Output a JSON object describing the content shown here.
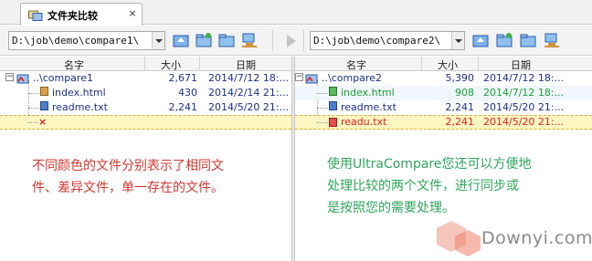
{
  "tab": {
    "label": "文件夹比较",
    "close": "×"
  },
  "left": {
    "path": "D:\\job\\demo\\compare1\\",
    "headers": {
      "name": "名字",
      "size": "大小",
      "date": "日期"
    },
    "rows": [
      {
        "name": "..\\compare1",
        "size": "2,671",
        "date": "2014/7/12 18:...",
        "color": "#1b2f8a",
        "icon": "folder-icon"
      },
      {
        "name": "index.html",
        "size": "430",
        "date": "2014/2/14 21:...",
        "color": "#1b2f8a",
        "icon": "html-file-icon"
      },
      {
        "name": "readme.txt",
        "size": "2,241",
        "date": "2014/5/20 21:...",
        "color": "#1b2f8a",
        "icon": "txt-file-icon"
      },
      {
        "name": "×",
        "size": "",
        "date": "",
        "color": "#e02020",
        "icon": "missing-file-icon"
      }
    ]
  },
  "right": {
    "path": "D:\\job\\demo\\compare2\\",
    "headers": {
      "name": "名字",
      "size": "大小",
      "date": "日期"
    },
    "rows": [
      {
        "name": "..\\compare2",
        "size": "5,390",
        "date": "2014/7/12 18:...",
        "color": "#1b2f8a",
        "icon": "folder-icon"
      },
      {
        "name": "index.html",
        "size": "908",
        "date": "2014/7/12 18:...",
        "color": "#18a030",
        "icon": "html-file-icon"
      },
      {
        "name": "readme.txt",
        "size": "2,241",
        "date": "2014/5/20 21:...",
        "color": "#1b2f8a",
        "icon": "txt-file-icon"
      },
      {
        "name": "readu.txt",
        "size": "2,241",
        "date": "2014/5/20 21:...",
        "color": "#e02020",
        "icon": "txt-file-icon"
      }
    ]
  },
  "notes": {
    "left_line1": "不同颜色的文件分别表示了相同文",
    "left_line2": "件、差异文件，单一存在的文件。",
    "right_line1": "使用UltraCompare您还可以方便地",
    "right_line2": "处理比较的两个文件，进行同步或",
    "right_line3": "是按照您的需要处理。"
  },
  "watermark": {
    "text": "Downyi.com"
  },
  "colors": {
    "same": "#1b2f8a",
    "different": "#18a030",
    "orphan": "#e02020",
    "highlight": "#fff6c2"
  }
}
